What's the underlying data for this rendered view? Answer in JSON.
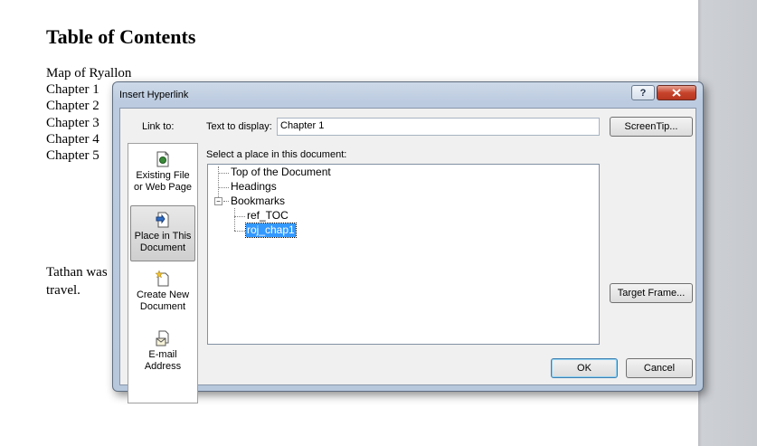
{
  "document": {
    "heading": "Table of Contents",
    "toc_lines": [
      "Map of Ryallon",
      "Chapter 1",
      "Chapter 2",
      "Chapter 3",
      "Chapter 4",
      "Chapter 5"
    ],
    "body_line1": "Tathan was",
    "body_line2": "travel."
  },
  "dialog": {
    "title": "Insert Hyperlink",
    "help": "?",
    "close": "X",
    "link_to_label": "Link to:",
    "link_to_items": [
      {
        "label": "Existing File or Web Page",
        "icon": "web-page-icon"
      },
      {
        "label": "Place in This Document",
        "icon": "document-place-icon"
      },
      {
        "label": "Create New Document",
        "icon": "new-document-icon"
      },
      {
        "label": "E-mail Address",
        "icon": "email-icon"
      }
    ],
    "text_to_display_label": "Text to display:",
    "text_to_display_value": "Chapter 1",
    "screentip_button": "ScreenTip...",
    "select_place_label": "Select a place in this document:",
    "tree": {
      "top": "Top of the Document",
      "headings": "Headings",
      "bookmarks": "Bookmarks",
      "bookmark_items": [
        "ref_TOC",
        "roj_chap1"
      ],
      "selected": "roj_chap1"
    },
    "target_frame_button": "Target Frame...",
    "ok_button": "OK",
    "cancel_button": "Cancel"
  }
}
